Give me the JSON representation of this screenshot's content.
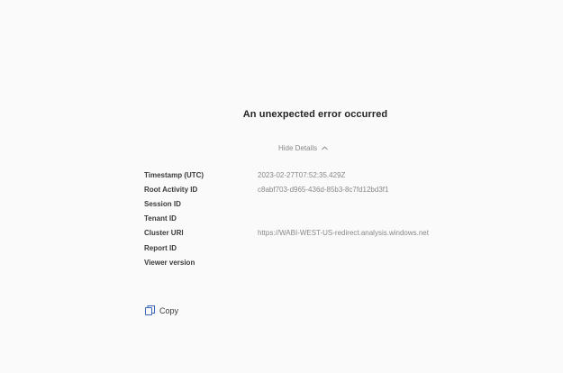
{
  "error": {
    "title": "An unexpected error occurred",
    "toggle_label": "Hide Details",
    "toggle_icon": "chevron-up-icon"
  },
  "details": [
    {
      "label": "Timestamp (UTC)",
      "value": "2023-02-27T07:52:35.429Z"
    },
    {
      "label": "Root Activity ID",
      "value": "c8abf703-d965-436d-85b3-8c7fd12bd3f1"
    },
    {
      "label": "Session ID",
      "value": ""
    },
    {
      "label": "Tenant ID",
      "value": ""
    },
    {
      "label": "Cluster URI",
      "value": "https://WABI-WEST-US-redirect.analysis.windows.net"
    },
    {
      "label": "Report ID",
      "value": ""
    },
    {
      "label": "Viewer version",
      "value": ""
    }
  ],
  "copy": {
    "label": "Copy",
    "icon": "copy-icon"
  },
  "colors": {
    "background": "#fafafa",
    "title": "#252423",
    "label": "#3b3a39",
    "muted": "#8a8886",
    "accent": "#3a67b8"
  }
}
